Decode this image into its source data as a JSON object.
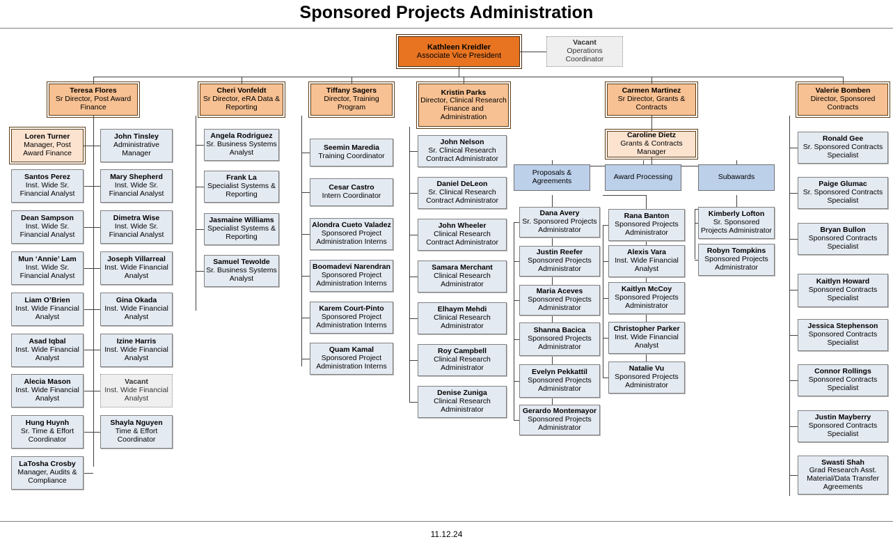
{
  "page": {
    "title": "Sponsored Projects Administration",
    "footer_date": "11.12.24"
  },
  "colors": {
    "executive": "#e87422",
    "director": "#f7c193",
    "manager": "#fbe3d0",
    "staff": "#e4eaf2",
    "group_header": "#bcd0ea",
    "vacant": "#efefef",
    "line": "#404040"
  },
  "nodes": {
    "exec": {
      "name": "Kathleen Kreidler",
      "title": "Associate Vice President"
    },
    "exec_assistant": {
      "name": "Vacant",
      "title": "Operations Coordinator"
    },
    "col1_head": {
      "name": "Teresa Flores",
      "title": "Sr Director, Post Award Finance"
    },
    "col1": [
      {
        "name": "Loren Turner",
        "title": "Manager, Post Award Finance"
      },
      {
        "name": "John Tinsley",
        "title": "Administrative Manager"
      },
      {
        "name": "Santos Perez",
        "title": "Inst. Wide Sr. Financial Analyst"
      },
      {
        "name": "Mary Shepherd",
        "title": "Inst. Wide Sr. Financial Analyst"
      },
      {
        "name": "Dean Sampson",
        "title": "Inst. Wide Sr. Financial Analyst"
      },
      {
        "name": "Dimetra Wise",
        "title": "Inst. Wide Sr. Financial Analyst"
      },
      {
        "name": "Mun ‘Annie’ Lam",
        "title": "Inst. Wide Sr. Financial Analyst"
      },
      {
        "name": "Joseph Villarreal",
        "title": "Inst. Wide Financial Analyst"
      },
      {
        "name": "Liam O’Brien",
        "title": "Inst. Wide Financial Analyst"
      },
      {
        "name": "Gina Okada",
        "title": "Inst. Wide Financial Analyst"
      },
      {
        "name": "Asad Iqbal",
        "title": "Inst. Wide Financial Analyst"
      },
      {
        "name": "Izine Harris",
        "title": "Inst. Wide Financial Analyst"
      },
      {
        "name": "Alecia Mason",
        "title": "Inst. Wide Financial Analyst"
      },
      {
        "name": "Vacant",
        "title": "Inst. Wide Financial Analyst"
      },
      {
        "name": "Hung Huynh",
        "title": "Sr. Time & Effort Coordinator"
      },
      {
        "name": "Shayla Nguyen",
        "title": "Time & Effort Coordinator"
      },
      {
        "name": "LaTosha Crosby",
        "title": "Manager, Audits & Compliance"
      }
    ],
    "col2_head": {
      "name": "Cheri Vonfeldt",
      "title": "Sr Director, eRA Data & Reporting"
    },
    "col2": [
      {
        "name": "Angela Rodriguez",
        "title": "Sr. Business Systems Analyst"
      },
      {
        "name": "Frank La",
        "title": "Specialist Systems & Reporting"
      },
      {
        "name": "Jasmaine Williams",
        "title": "Specialist Systems & Reporting"
      },
      {
        "name": "Samuel Tewolde",
        "title": "Sr. Business Systems Analyst"
      }
    ],
    "col3_head": {
      "name": "Tiffany Sagers",
      "title": "Director, Training Program"
    },
    "col3": [
      {
        "name": "Seemin Maredia",
        "title": "Training Coordinator"
      },
      {
        "name": "Cesar Castro",
        "title": "Intern Coordinator"
      },
      {
        "name": "Alondra Cueto Valadez",
        "title": "Sponsored Project Administration Interns"
      },
      {
        "name": "Boomadevi Narendran",
        "title": "Sponsored Project Administration Interns"
      },
      {
        "name": "Karem Court-Pinto",
        "title": "Sponsored Project Administration Interns"
      },
      {
        "name": "Quam Kamal",
        "title": "Sponsored Project Administration Interns"
      }
    ],
    "col4_head": {
      "name": "Kristin Parks",
      "title": "Director, Clinical Research Finance and Administration"
    },
    "col4": [
      {
        "name": "John Nelson",
        "title": "Sr. Clinical Research Contract Administrator"
      },
      {
        "name": "Daniel DeLeon",
        "title": "Sr. Clinical Research Contract Administrator"
      },
      {
        "name": "John Wheeler",
        "title": "Clinical Research Contract Administrator"
      },
      {
        "name": "Samara Merchant",
        "title": "Clinical Research Administrator"
      },
      {
        "name": "Elhaym Mehdi",
        "title": "Clinical Research Administrator"
      },
      {
        "name": "Roy Campbell",
        "title": "Clinical Research Administrator"
      },
      {
        "name": "Denise Zuniga",
        "title": "Clinical Research Administrator"
      }
    ],
    "col5_head": {
      "name": "Carmen Martinez",
      "title": "Sr Director, Grants & Contracts"
    },
    "col5_manager": {
      "name": "Caroline Dietz",
      "title": "Grants & Contracts Manager"
    },
    "group_a": {
      "label": "Proposals & Agreements"
    },
    "group_a_members": [
      {
        "name": "Dana Avery",
        "title": "Sr. Sponsored Projects Administrator"
      },
      {
        "name": "Justin Reefer",
        "title": "Sponsored Projects Administrator"
      },
      {
        "name": "Maria Aceves",
        "title": "Sponsored Projects Administrator"
      },
      {
        "name": "Shanna Bacica",
        "title": "Sponsored Projects Administrator"
      },
      {
        "name": "Evelyn Pekkattil",
        "title": "Sponsored Projects Administrator"
      },
      {
        "name": "Gerardo Montemayor",
        "title": "Sponsored Projects Administrator"
      }
    ],
    "group_b": {
      "label": "Award Processing"
    },
    "group_b_members": [
      {
        "name": "Rana Banton",
        "title": "Sponsored Projects Administrator"
      },
      {
        "name": "Alexis Vara",
        "title": "Inst. Wide Financial Analyst"
      },
      {
        "name": "Kaitlyn McCoy",
        "title": "Sponsored Projects Administrator"
      },
      {
        "name": "Christopher Parker",
        "title": "Inst. Wide Financial Analyst"
      },
      {
        "name": "Natalie Vu",
        "title": "Sponsored Projects Administrator"
      }
    ],
    "group_c": {
      "label": "Subawards"
    },
    "group_c_members": [
      {
        "name": "Kimberly Lofton",
        "title": "Sr. Sponsored Projects Administrator"
      },
      {
        "name": "Robyn Tompkins",
        "title": "Sponsored Projects Administrator"
      }
    ],
    "col6_head": {
      "name": "Valerie Bomben",
      "title": "Director, Sponsored Contracts"
    },
    "col6": [
      {
        "name": "Ronald Gee",
        "title": "Sr. Sponsored Contracts Specialist"
      },
      {
        "name": "Paige Glumac",
        "title": "Sr. Sponsored Contracts Specialist"
      },
      {
        "name": "Bryan Bullon",
        "title": "Sponsored Contracts Specialist"
      },
      {
        "name": "Kaitlyn Howard",
        "title": "Sponsored Contracts Specialist"
      },
      {
        "name": "Jessica Stephenson",
        "title": "Sponsored Contracts Specialist"
      },
      {
        "name": "Connor Rollings",
        "title": "Sponsored Contracts Specialist"
      },
      {
        "name": "Justin Mayberry",
        "title": "Sponsored Contracts Specialist"
      },
      {
        "name": "Swasti Shah",
        "title": "Grad Research Asst. Material/Data Transfer Agreements"
      }
    ]
  }
}
